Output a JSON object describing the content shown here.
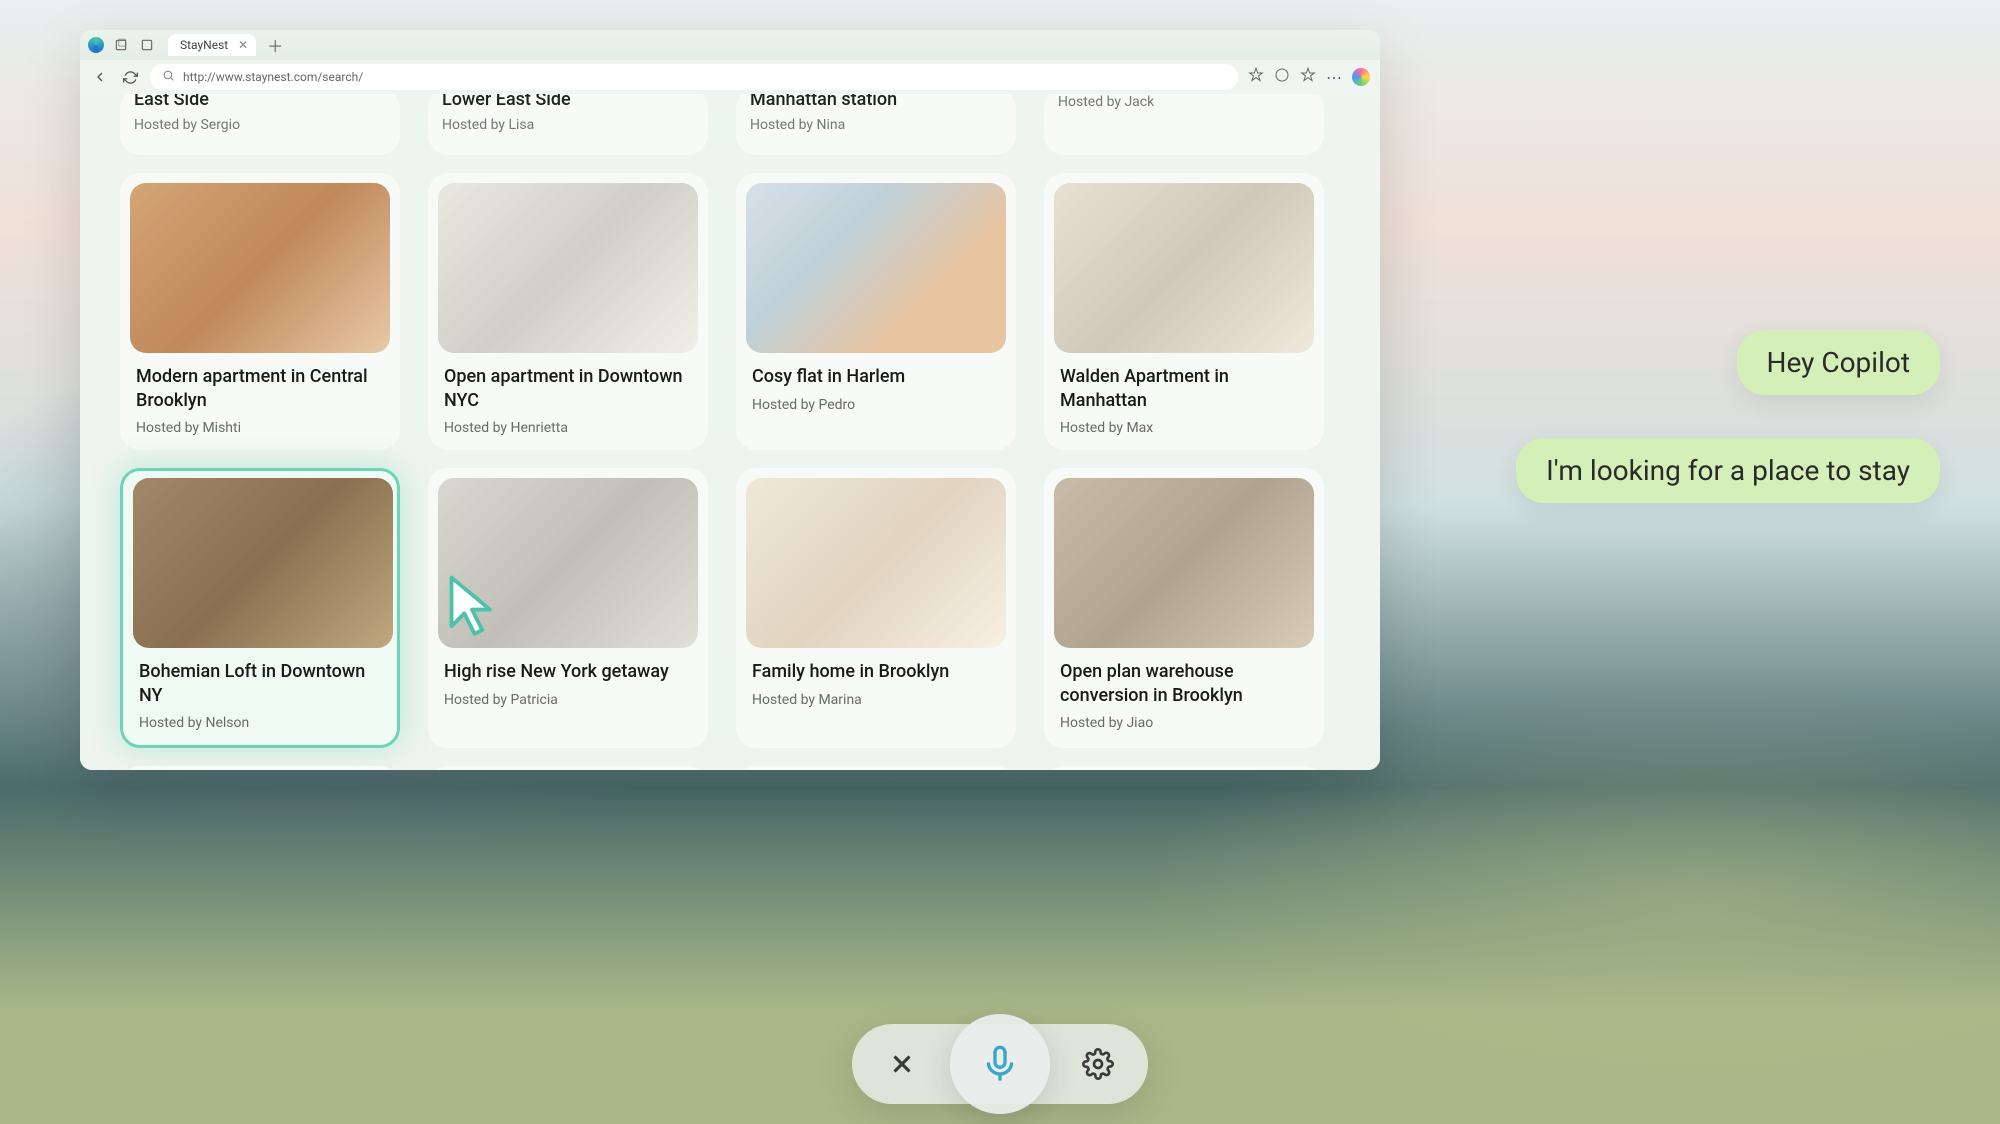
{
  "browser": {
    "tab_title": "StayNest",
    "url": "http://www.staynest.com/search/"
  },
  "partial_listings": [
    {
      "title": "East Side",
      "host": "Hosted by Sergio"
    },
    {
      "title": "Lower East Side",
      "host": "Hosted by Lisa"
    },
    {
      "title": "Manhattan station",
      "host": "Hosted by Nina"
    },
    {
      "title": "",
      "host": "Hosted by Jack"
    }
  ],
  "row1": [
    {
      "title": "Modern apartment in Central Brooklyn",
      "host": "Hosted by Mishti",
      "tone": "warm"
    },
    {
      "title": "Open apartment in Downtown NYC",
      "host": "Hosted by Henrietta",
      "tone": "light"
    },
    {
      "title": "Cosy flat in Harlem",
      "host": "Hosted by Pedro",
      "tone": "blue"
    },
    {
      "title": "Walden Apartment in Manhattan",
      "host": "Hosted by Max",
      "tone": "neutral"
    }
  ],
  "row2": [
    {
      "title": "Bohemian Loft in Downtown NY",
      "host": "Hosted by Nelson",
      "tone": "dark",
      "highlighted": true
    },
    {
      "title": "High rise New York getaway",
      "host": "Hosted by Patricia",
      "tone": "grey"
    },
    {
      "title": "Family home in Brooklyn",
      "host": "Hosted by Marina",
      "tone": "kitchen"
    },
    {
      "title": "Open plan warehouse conversion in Brooklyn",
      "host": "Hosted by Jiao",
      "tone": "cozy"
    }
  ],
  "copilot": {
    "bubble1": "Hey Copilot",
    "bubble2": "I'm looking for a place to stay"
  }
}
